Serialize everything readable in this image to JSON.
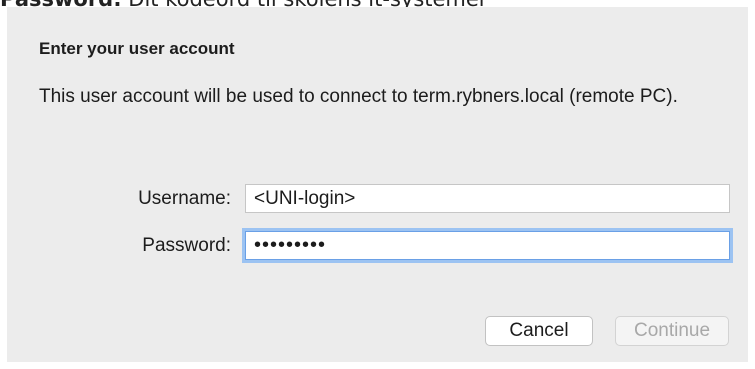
{
  "document": {
    "label": "Password:",
    "text": " Dit kodeord til skolens it-systemer"
  },
  "dialog": {
    "heading": "Enter your user account",
    "description": "This user account will be used to connect to term.rybners.local (remote PC).",
    "username": {
      "label": "Username:",
      "value": "<UNI-login>"
    },
    "password": {
      "label": "Password:",
      "value": "123456789"
    },
    "buttons": {
      "cancel": "Cancel",
      "continue": "Continue"
    }
  },
  "colors": {
    "dialog_background": "#ececec",
    "focus_ring": "#9cc3f2",
    "disabled_text": "#a8a8a8"
  }
}
